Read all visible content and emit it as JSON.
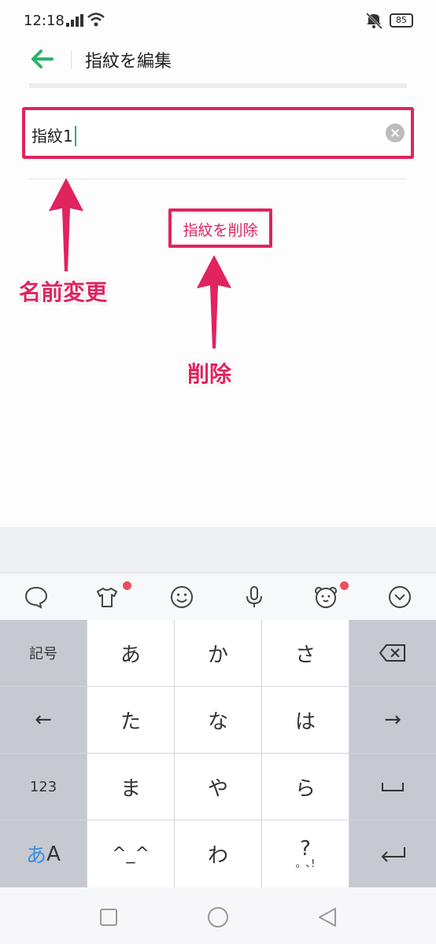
{
  "status": {
    "time": "12:18",
    "battery": "85"
  },
  "header": {
    "title": "指紋を編集"
  },
  "name_field": {
    "value": "指紋1"
  },
  "delete": {
    "label": "指紋を削除"
  },
  "annotations": {
    "rename": "名前変更",
    "delete": "削除"
  },
  "colors": {
    "accent": "#e0245e",
    "back_arrow": "#2cb36b",
    "badge": "#e8505b"
  },
  "keyboard": {
    "toolbar": [
      "chat-bubble-icon",
      "tshirt-icon",
      "smiley-icon",
      "microphone-icon",
      "bear-icon",
      "chevron-down-icon"
    ],
    "rows": [
      [
        "記号",
        "あ",
        "か",
        "さ",
        "backspace"
      ],
      [
        "←",
        "た",
        "な",
        "は",
        "→"
      ],
      [
        "123",
        "ま",
        "や",
        "ら",
        "space"
      ],
      [
        "あA",
        "^_^",
        "わ",
        "?。､!",
        "enter"
      ]
    ],
    "labels": {
      "symbols": "記号",
      "a": "あ",
      "ka": "か",
      "sa": "さ",
      "left": "←",
      "ta": "た",
      "na": "な",
      "ha": "は",
      "right": "→",
      "num": "123",
      "ma": "ま",
      "ya": "や",
      "ra": "ら",
      "kana_a": "あ",
      "kana_A": "A",
      "emoticon": "^_^",
      "wa": "わ",
      "punct_q": "?",
      "punct_rest": "。､!"
    }
  }
}
